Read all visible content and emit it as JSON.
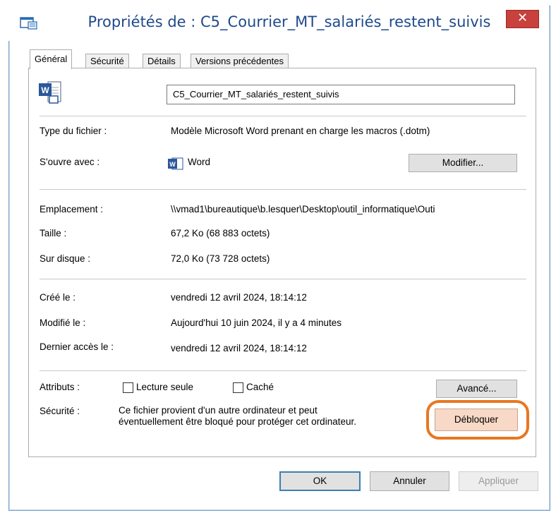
{
  "window": {
    "title": "Propriétés de : C5_Courrier_MT_salariés_restent_suivis",
    "close_glyph": "✕"
  },
  "tabs": [
    {
      "label": "Général"
    },
    {
      "label": "Sécurité"
    },
    {
      "label": "Détails"
    },
    {
      "label": "Versions précédentes"
    }
  ],
  "general": {
    "file_name": "C5_Courrier_MT_salariés_restent_suivis",
    "file_type_label": "Type du fichier :",
    "file_type_value": "Modèle Microsoft Word prenant en charge les macros (.dotm)",
    "opens_with_label": "S'ouvre avec :",
    "opens_with_value": "Word",
    "change_button": "Modifier...",
    "location_label": "Emplacement :",
    "location_value": "\\\\vmad1\\bureautique\\b.lesquer\\Desktop\\outil_informatique\\Outi",
    "size_label": "Taille :",
    "size_value": "67,2 Ko (68 883 octets)",
    "disk_label": "Sur disque :",
    "disk_value": "72,0 Ko (73 728 octets)",
    "created_label": "Créé le :",
    "created_value": "vendredi 12 avril 2024, 18:14:12",
    "modified_label": "Modifié le :",
    "modified_value": "Aujourd'hui 10 juin 2024, il y a 4 minutes",
    "accessed_label": "Dernier accès le :",
    "accessed_value": "vendredi 12 avril 2024, 18:14:12",
    "attributes_label": "Attributs :",
    "readonly_label": "Lecture seule",
    "readonly_checked": false,
    "hidden_label": "Caché",
    "hidden_checked": false,
    "advanced_button": "Avancé...",
    "security_label": "Sécurité :",
    "security_line1": "Ce fichier provient d'un autre ordinateur et peut",
    "security_line2": "éventuellement être bloqué pour protéger cet ordinateur.",
    "unblock_button": "Débloquer"
  },
  "footer": {
    "ok_button": "OK",
    "cancel_button": "Annuler",
    "apply_button": "Appliquer"
  },
  "colors": {
    "title_text": "#1f4a8a",
    "close_button": "#c8413c",
    "highlight_ring": "#e87722",
    "word_blue": "#2b579a"
  }
}
